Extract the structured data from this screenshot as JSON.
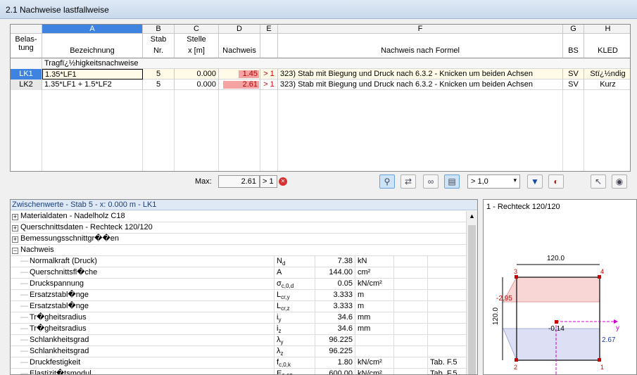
{
  "title": "2.1  Nachweise lastfallweise",
  "columns": {
    "rowhead": {
      "l1": "Belas-",
      "l2": "tung"
    },
    "A": {
      "letter": "A",
      "l1": "",
      "l2": "Bezeichnung"
    },
    "B": {
      "letter": "B",
      "l1": "Stab",
      "l2": "Nr."
    },
    "C": {
      "letter": "C",
      "l1": "Stelle",
      "l2": "x [m]"
    },
    "D": {
      "letter": "D",
      "l1": "",
      "l2": "Nachweis"
    },
    "E": {
      "letter": "E",
      "l1": "",
      "l2": ""
    },
    "F": {
      "letter": "F",
      "l1": "",
      "l2": "Nachweis nach Formel"
    },
    "G": {
      "letter": "G",
      "l1": "",
      "l2": "BS"
    },
    "H": {
      "letter": "H",
      "l1": "",
      "l2": "KLED"
    }
  },
  "group_label": "Tragfï¿½higkeitsnachweise",
  "rows": [
    {
      "id": "LK1",
      "bez": "1.35*LF1",
      "stab": "5",
      "stelle": "0.000",
      "nachweis": "1.45",
      "nachweis_ratio": 0.56,
      "flag": "> 1",
      "formel": "323) Stab mit Biegung und Druck nach 6.3.2 - Knicken um beiden Achsen",
      "bs": "SV",
      "kled": "Stï¿½ndig"
    },
    {
      "id": "LK2",
      "bez": "1.35*LF1 + 1.5*LF2",
      "stab": "5",
      "stelle": "0.000",
      "nachweis": "2.61",
      "nachweis_ratio": 1.0,
      "flag": "> 1",
      "formel": "323) Stab mit Biegung und Druck nach 6.3.2 - Knicken um beiden Achsen",
      "bs": "SV",
      "kled": "Kurz"
    }
  ],
  "max": {
    "label": "Max:",
    "value": "2.61",
    "flag": "> 1"
  },
  "filter_select": "> 1,0",
  "lower": {
    "header": "Zwischenwerte - Stab 5 - x: 0.000 m - LK1",
    "groups": [
      {
        "label": "Materialdaten - Nadelholz C18",
        "sign": "+"
      },
      {
        "label": "Querschnittsdaten - Rechteck 120/120",
        "sign": "+"
      },
      {
        "label": "Bemessungsschnittgr��en",
        "sign": "+"
      },
      {
        "label": "Nachweis",
        "sign": "−"
      }
    ],
    "items": [
      {
        "name": "Normalkraft (Druck)",
        "sym": "N",
        "sub": "d",
        "val": "7.38",
        "unit": "kN",
        "ref": ""
      },
      {
        "name": "Querschnittsfl�che",
        "sym": "A",
        "sub": "",
        "val": "144.00",
        "unit": "cm²",
        "ref": ""
      },
      {
        "name": "Druckspannung",
        "sym": "σ",
        "sub": "c,0,d",
        "val": "0.05",
        "unit": "kN/cm²",
        "ref": ""
      },
      {
        "name": "Ersatzstabl�nge",
        "sym": "L",
        "sub": "cr,y",
        "val": "3.333",
        "unit": "m",
        "ref": ""
      },
      {
        "name": "Ersatzstabl�nge",
        "sym": "L",
        "sub": "cr,z",
        "val": "3.333",
        "unit": "m",
        "ref": ""
      },
      {
        "name": "Tr�gheitsradius",
        "sym": "i",
        "sub": "y",
        "val": "34.6",
        "unit": "mm",
        "ref": ""
      },
      {
        "name": "Tr�gheitsradius",
        "sym": "i",
        "sub": "z",
        "val": "34.6",
        "unit": "mm",
        "ref": ""
      },
      {
        "name": "Schlankheitsgrad",
        "sym": "λ",
        "sub": "y",
        "val": "96.225",
        "unit": "",
        "ref": ""
      },
      {
        "name": "Schlankheitsgrad",
        "sym": "λ",
        "sub": "z",
        "val": "96.225",
        "unit": "",
        "ref": ""
      },
      {
        "name": "Druckfestigkeit",
        "sym": "f",
        "sub": "c,0,k",
        "val": "1.80",
        "unit": "kN/cm²",
        "ref": "Tab. F.5"
      },
      {
        "name": "Elastizit�tsmodul",
        "sym": "E",
        "sub": "0,05",
        "val": "600.00",
        "unit": "kN/cm²",
        "ref": "Tab. F.5"
      }
    ]
  },
  "section": {
    "title": "1 - Rechteck 120/120",
    "dim_top": "120.0",
    "dim_left": "120.0",
    "corner1": "1",
    "corner2": "2",
    "corner3": "3",
    "corner4": "4",
    "v_left": "-2.95",
    "v_center": "-0.14",
    "v_right": "2.67",
    "axis_y": "y"
  }
}
